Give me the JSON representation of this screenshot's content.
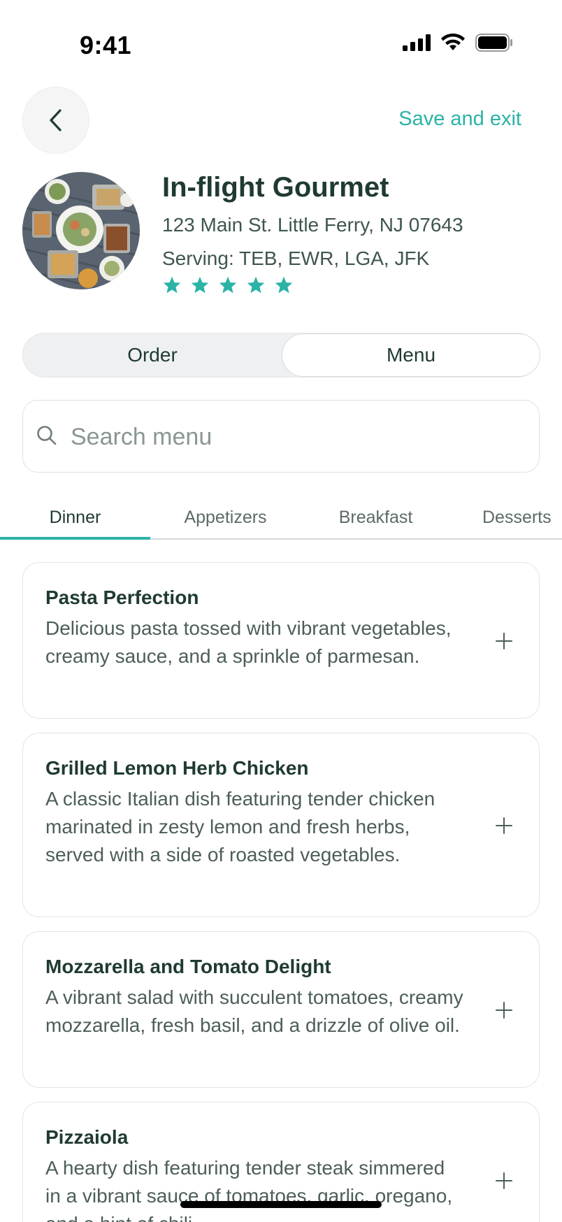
{
  "status_bar": {
    "time": "9:41"
  },
  "nav": {
    "save_exit": "Save and exit"
  },
  "vendor": {
    "name": "In-flight Gourmet",
    "address": "123 Main St. Little Ferry, NJ 07643",
    "serving": "Serving: TEB, EWR, LGA, JFK",
    "rating": 5,
    "rating_max": 5
  },
  "segments": {
    "order": "Order",
    "menu": "Menu",
    "selected": "Menu"
  },
  "search": {
    "placeholder": "Search menu",
    "value": ""
  },
  "categories": [
    {
      "label": "Dinner",
      "active": true
    },
    {
      "label": "Appetizers",
      "active": false
    },
    {
      "label": "Breakfast",
      "active": false
    },
    {
      "label": "Desserts",
      "active": false
    }
  ],
  "menu_items": [
    {
      "name": "Pasta Perfection",
      "description": "Delicious pasta tossed with vibrant vegetables, creamy sauce, and a sprinkle of parmesan."
    },
    {
      "name": "Grilled Lemon Herb Chicken",
      "description": "A classic Italian dish featuring tender chicken marinated in zesty lemon and fresh herbs, served with a side of roasted vegetables."
    },
    {
      "name": "Mozzarella and Tomato Delight",
      "description": "A vibrant salad with succulent tomatoes, creamy mozzarella, fresh basil, and a drizzle of olive oil."
    },
    {
      "name": "Pizzaiola",
      "description": "A hearty dish featuring tender steak simmered in a vibrant sauce of tomatoes, garlic, oregano, and a hint of chili."
    }
  ],
  "colors": {
    "accent": "#2bb3a6",
    "text_primary": "#1f3a33",
    "star": "#2bb3a6"
  },
  "icons": {
    "back": "chevron-left-icon",
    "search": "search-icon",
    "add": "plus-icon",
    "star": "star-icon"
  }
}
